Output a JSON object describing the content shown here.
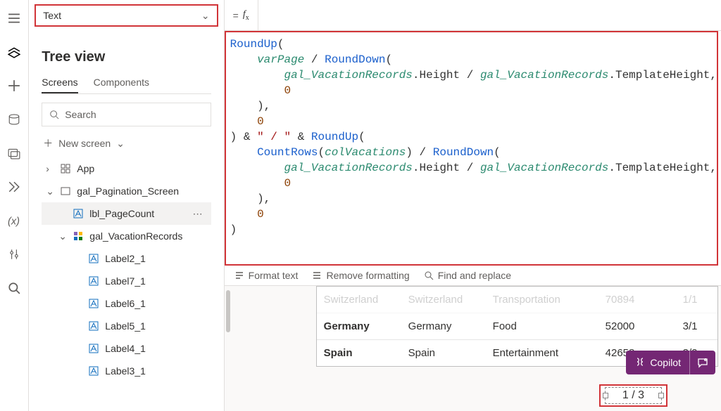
{
  "property_dropdown": {
    "value": "Text"
  },
  "fx_label": "fx",
  "tree": {
    "title": "Tree view",
    "tabs": {
      "screens": "Screens",
      "components": "Components"
    },
    "search_placeholder": "Search",
    "new_screen": "New screen",
    "items": {
      "app": "App",
      "screen": "gal_Pagination_Screen",
      "selected": "lbl_PageCount",
      "gallery": "gal_VacationRecords",
      "label2": "Label2_1",
      "label7": "Label7_1",
      "label6": "Label6_1",
      "label5": "Label5_1",
      "label4": "Label4_1",
      "label3": "Label3_1"
    }
  },
  "formula_toolbar": {
    "format": "Format text",
    "remove": "Remove formatting",
    "find": "Find and replace"
  },
  "formula_tokens": {
    "RoundUp": "RoundUp",
    "RoundDown": "RoundDown",
    "CountRows": "CountRows",
    "varPage": "varPage",
    "gal": "gal_VacationRecords",
    "col": "colVacations",
    "Height": ".Height",
    "TplHeight": ".TemplateHeight,",
    "zero": "0",
    "sep": " / ",
    "strSep": "\" / \"",
    "amp": " & "
  },
  "grid": {
    "rows": [
      {
        "c1": "Switzerland",
        "c2": "Switzerland",
        "c3": "Transportation",
        "c4": "70894",
        "c5": "1/1"
      },
      {
        "c1": "Germany",
        "c2": "Germany",
        "c3": "Food",
        "c4": "52000",
        "c5": "3/1"
      },
      {
        "c1": "Spain",
        "c2": "Spain",
        "c3": "Entertainment",
        "c4": "42658",
        "c5": "3/2"
      }
    ]
  },
  "pager": {
    "text": "1 / 3"
  },
  "copilot": {
    "label": "Copilot"
  }
}
